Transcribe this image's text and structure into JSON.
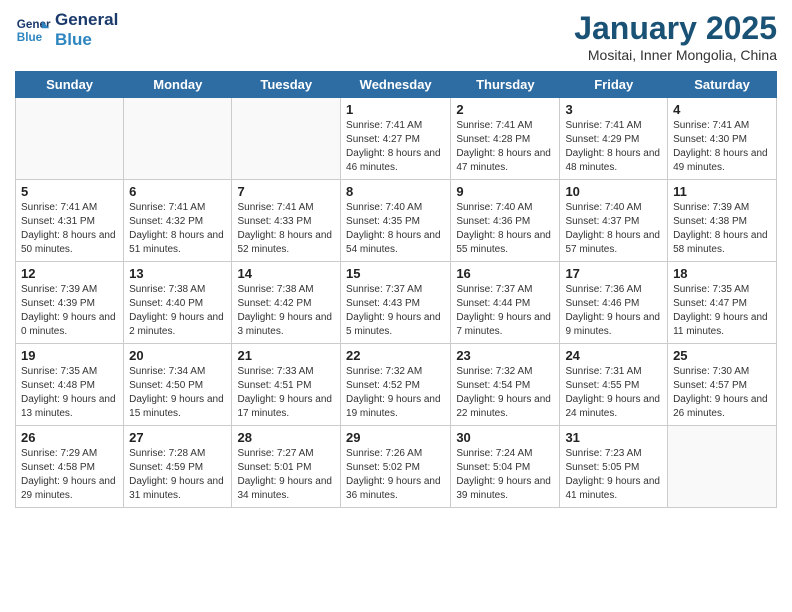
{
  "header": {
    "logo_line1": "General",
    "logo_line2": "Blue",
    "title": "January 2025",
    "subtitle": "Mositai, Inner Mongolia, China"
  },
  "days_of_week": [
    "Sunday",
    "Monday",
    "Tuesday",
    "Wednesday",
    "Thursday",
    "Friday",
    "Saturday"
  ],
  "weeks": [
    [
      {
        "day": "",
        "detail": ""
      },
      {
        "day": "",
        "detail": ""
      },
      {
        "day": "",
        "detail": ""
      },
      {
        "day": "1",
        "detail": "Sunrise: 7:41 AM\nSunset: 4:27 PM\nDaylight: 8 hours and 46 minutes."
      },
      {
        "day": "2",
        "detail": "Sunrise: 7:41 AM\nSunset: 4:28 PM\nDaylight: 8 hours and 47 minutes."
      },
      {
        "day": "3",
        "detail": "Sunrise: 7:41 AM\nSunset: 4:29 PM\nDaylight: 8 hours and 48 minutes."
      },
      {
        "day": "4",
        "detail": "Sunrise: 7:41 AM\nSunset: 4:30 PM\nDaylight: 8 hours and 49 minutes."
      }
    ],
    [
      {
        "day": "5",
        "detail": "Sunrise: 7:41 AM\nSunset: 4:31 PM\nDaylight: 8 hours and 50 minutes."
      },
      {
        "day": "6",
        "detail": "Sunrise: 7:41 AM\nSunset: 4:32 PM\nDaylight: 8 hours and 51 minutes."
      },
      {
        "day": "7",
        "detail": "Sunrise: 7:41 AM\nSunset: 4:33 PM\nDaylight: 8 hours and 52 minutes."
      },
      {
        "day": "8",
        "detail": "Sunrise: 7:40 AM\nSunset: 4:35 PM\nDaylight: 8 hours and 54 minutes."
      },
      {
        "day": "9",
        "detail": "Sunrise: 7:40 AM\nSunset: 4:36 PM\nDaylight: 8 hours and 55 minutes."
      },
      {
        "day": "10",
        "detail": "Sunrise: 7:40 AM\nSunset: 4:37 PM\nDaylight: 8 hours and 57 minutes."
      },
      {
        "day": "11",
        "detail": "Sunrise: 7:39 AM\nSunset: 4:38 PM\nDaylight: 8 hours and 58 minutes."
      }
    ],
    [
      {
        "day": "12",
        "detail": "Sunrise: 7:39 AM\nSunset: 4:39 PM\nDaylight: 9 hours and 0 minutes."
      },
      {
        "day": "13",
        "detail": "Sunrise: 7:38 AM\nSunset: 4:40 PM\nDaylight: 9 hours and 2 minutes."
      },
      {
        "day": "14",
        "detail": "Sunrise: 7:38 AM\nSunset: 4:42 PM\nDaylight: 9 hours and 3 minutes."
      },
      {
        "day": "15",
        "detail": "Sunrise: 7:37 AM\nSunset: 4:43 PM\nDaylight: 9 hours and 5 minutes."
      },
      {
        "day": "16",
        "detail": "Sunrise: 7:37 AM\nSunset: 4:44 PM\nDaylight: 9 hours and 7 minutes."
      },
      {
        "day": "17",
        "detail": "Sunrise: 7:36 AM\nSunset: 4:46 PM\nDaylight: 9 hours and 9 minutes."
      },
      {
        "day": "18",
        "detail": "Sunrise: 7:35 AM\nSunset: 4:47 PM\nDaylight: 9 hours and 11 minutes."
      }
    ],
    [
      {
        "day": "19",
        "detail": "Sunrise: 7:35 AM\nSunset: 4:48 PM\nDaylight: 9 hours and 13 minutes."
      },
      {
        "day": "20",
        "detail": "Sunrise: 7:34 AM\nSunset: 4:50 PM\nDaylight: 9 hours and 15 minutes."
      },
      {
        "day": "21",
        "detail": "Sunrise: 7:33 AM\nSunset: 4:51 PM\nDaylight: 9 hours and 17 minutes."
      },
      {
        "day": "22",
        "detail": "Sunrise: 7:32 AM\nSunset: 4:52 PM\nDaylight: 9 hours and 19 minutes."
      },
      {
        "day": "23",
        "detail": "Sunrise: 7:32 AM\nSunset: 4:54 PM\nDaylight: 9 hours and 22 minutes."
      },
      {
        "day": "24",
        "detail": "Sunrise: 7:31 AM\nSunset: 4:55 PM\nDaylight: 9 hours and 24 minutes."
      },
      {
        "day": "25",
        "detail": "Sunrise: 7:30 AM\nSunset: 4:57 PM\nDaylight: 9 hours and 26 minutes."
      }
    ],
    [
      {
        "day": "26",
        "detail": "Sunrise: 7:29 AM\nSunset: 4:58 PM\nDaylight: 9 hours and 29 minutes."
      },
      {
        "day": "27",
        "detail": "Sunrise: 7:28 AM\nSunset: 4:59 PM\nDaylight: 9 hours and 31 minutes."
      },
      {
        "day": "28",
        "detail": "Sunrise: 7:27 AM\nSunset: 5:01 PM\nDaylight: 9 hours and 34 minutes."
      },
      {
        "day": "29",
        "detail": "Sunrise: 7:26 AM\nSunset: 5:02 PM\nDaylight: 9 hours and 36 minutes."
      },
      {
        "day": "30",
        "detail": "Sunrise: 7:24 AM\nSunset: 5:04 PM\nDaylight: 9 hours and 39 minutes."
      },
      {
        "day": "31",
        "detail": "Sunrise: 7:23 AM\nSunset: 5:05 PM\nDaylight: 9 hours and 41 minutes."
      },
      {
        "day": "",
        "detail": ""
      }
    ]
  ]
}
